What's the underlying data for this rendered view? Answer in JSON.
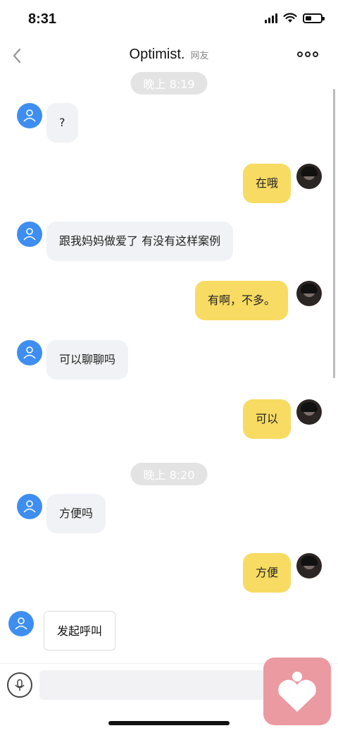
{
  "status_bar": {
    "time": "8:31"
  },
  "header": {
    "title": "Optimist.",
    "subtitle": "网友"
  },
  "timestamps": [
    "晚上 8:19",
    "晚上 8:20"
  ],
  "messages": [
    {
      "from": "them",
      "text": "?"
    },
    {
      "from": "me",
      "text": "在哦"
    },
    {
      "from": "them",
      "text": "跟我妈妈做爱了 有没有这样案例"
    },
    {
      "from": "me",
      "text": "有啊，不多。"
    },
    {
      "from": "them",
      "text": "可以聊聊吗"
    },
    {
      "from": "me",
      "text": "可以"
    },
    {
      "from": "them",
      "text": "方便吗"
    },
    {
      "from": "me",
      "text": "方便"
    },
    {
      "from": "them",
      "text": "发起呼叫"
    }
  ],
  "colors": {
    "incoming_bubble": "#f1f2f5",
    "outgoing_bubble": "#f7db62",
    "avatar_blue": "#3d8ef0",
    "fab": "#ea9aa0"
  },
  "input": {
    "placeholder": "",
    "value": ""
  }
}
